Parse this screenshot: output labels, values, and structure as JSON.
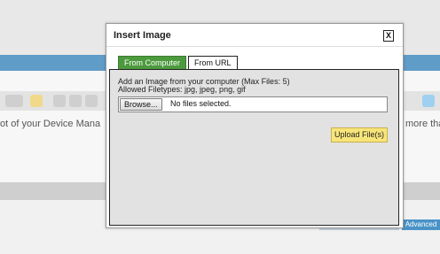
{
  "background": {
    "editor_text_left": "ot of your Device Mana",
    "editor_text_right": "more tha",
    "advanced_label": "Advanced"
  },
  "dialog": {
    "title": "Insert Image",
    "close_label": "X",
    "tabs": [
      {
        "label": "From Computer",
        "active": true
      },
      {
        "label": "From URL",
        "active": false
      }
    ],
    "instructions": "Add an Image from your computer (Max Files: 5)",
    "allowed_types": "Allowed Filetypes: jpg, jpeg, png, gif",
    "browse_label": "Browse...",
    "file_status": "No files selected.",
    "upload_label": "Upload File(s)"
  },
  "colors": {
    "header_blue": "#5f9cc8",
    "active_tab": "#4d9a3e",
    "upload_button": "#f8e57a"
  }
}
